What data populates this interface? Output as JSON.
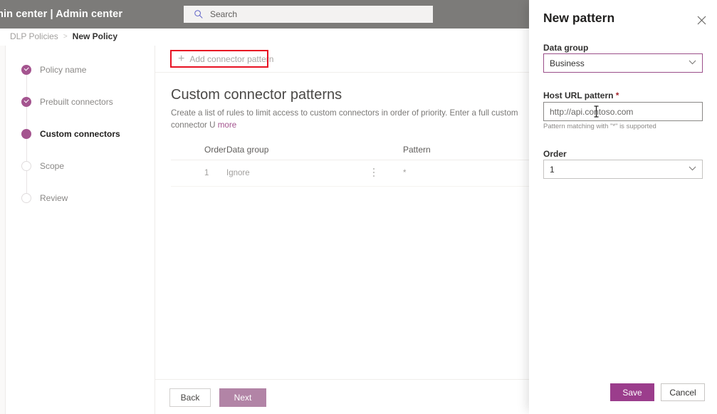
{
  "suite": {
    "title": "min center  |  Admin center",
    "search_placeholder": "Search",
    "search_icon": "search-icon"
  },
  "breadcrumb": {
    "parent": "DLP Policies",
    "separator": ">",
    "current": "New Policy"
  },
  "steps": [
    {
      "label": "Policy name",
      "state": "done"
    },
    {
      "label": "Prebuilt connectors",
      "state": "done"
    },
    {
      "label": "Custom connectors",
      "state": "current"
    },
    {
      "label": "Scope",
      "state": "todo"
    },
    {
      "label": "Review",
      "state": "todo"
    }
  ],
  "main": {
    "add_button": "Add connector pattern",
    "add_icon": "plus-icon",
    "section_title": "Custom connector patterns",
    "description": "Create a list of rules to limit access to custom connectors in order of priority. Enter a full custom connector U",
    "description_link": "more",
    "table": {
      "columns": [
        "Order",
        "Data group",
        "",
        "Pattern"
      ],
      "rows": [
        {
          "order": "1",
          "data_group": "Ignore",
          "menu_icon": "more-vertical-icon",
          "pattern": "*"
        }
      ]
    },
    "back_label": "Back",
    "next_label": "Next"
  },
  "panel": {
    "title": "New pattern",
    "close_icon": "close-icon",
    "data_group_label": "Data group",
    "data_group_value": "Business",
    "host_url_label": "Host URL pattern",
    "host_url_required": "*",
    "host_url_value": "http://api.contoso.com",
    "host_url_hint": "Pattern matching with \"*\" is supported",
    "order_label": "Order",
    "order_value": "1",
    "chevron_icon": "chevron-down-icon",
    "save_label": "Save",
    "cancel_label": "Cancel"
  },
  "colors": {
    "accent": "#9b3d8c",
    "step_done": "#a4548f",
    "annotation": "#e81123",
    "suite_bar": "#7c7b79",
    "next_button": "#b284a6"
  }
}
